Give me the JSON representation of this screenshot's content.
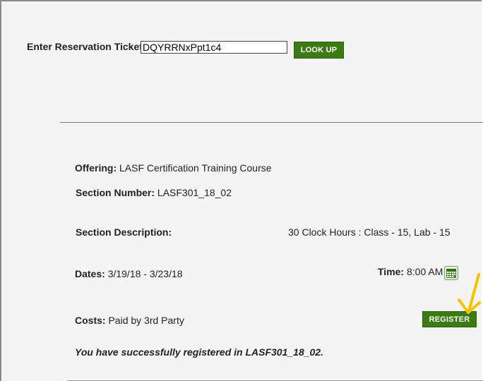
{
  "ticket": {
    "label": "Enter Reservation Ticket",
    "value": "DQYRRNxPpt1c4",
    "lookup_label": "LOOK UP"
  },
  "details": {
    "offering_label": "Offering:",
    "offering_value": "LASF Certification Training Course",
    "section_number_label": "Section Number:",
    "section_number_value": "LASF301_18_02",
    "section_description_label": "Section Description:",
    "section_description_value": "30 Clock Hours : Class - 15, Lab - 15",
    "dates_label": "Dates:",
    "dates_value": "3/19/18 - 3/23/18",
    "time_label": "Time:",
    "time_value": "8:00 AM",
    "costs_label": "Costs:",
    "costs_value": "Paid by 3rd Party",
    "register_label": "REGISTER",
    "success_message": "You have successfully registered in LASF301_18_02."
  },
  "icons": {
    "calendar": "calendar-icon",
    "annotation_arrow": "arrow-down-icon"
  },
  "colors": {
    "button_green": "#3c7a16",
    "arrow_yellow": "#f5c400",
    "background": "#f4f4f4"
  }
}
